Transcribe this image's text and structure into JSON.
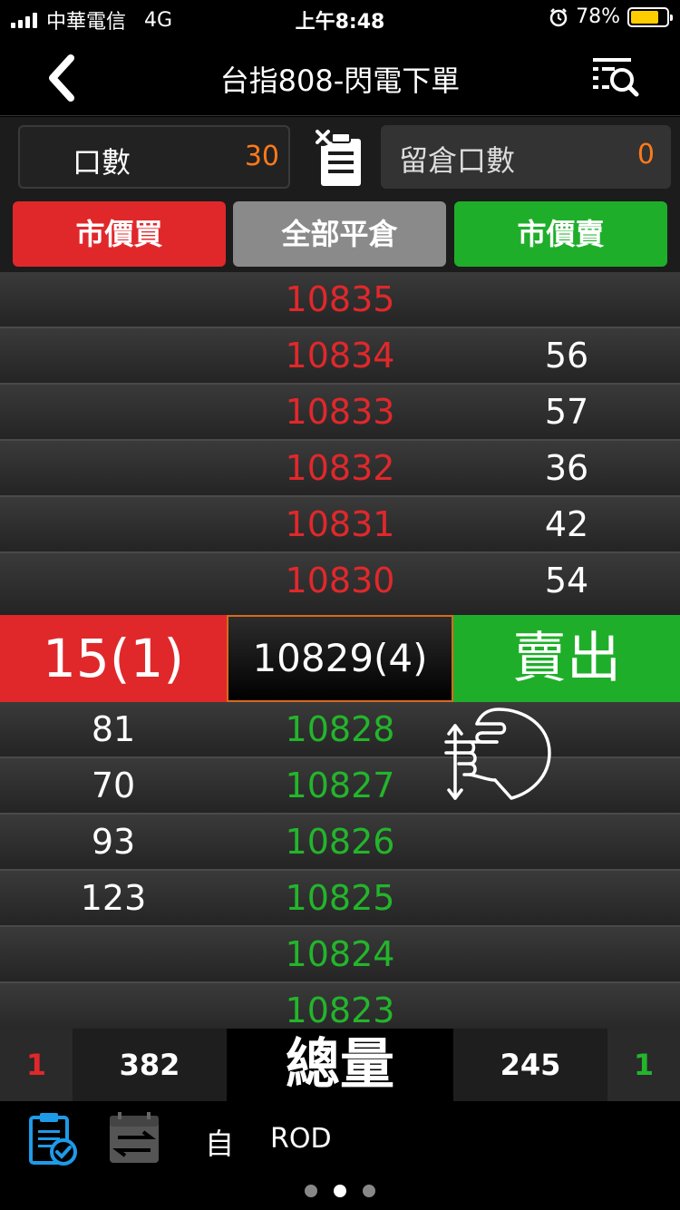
{
  "status_bar": {
    "carrier": "中華電信",
    "network": "4G",
    "time": "上午8:48",
    "battery_percent": "78%",
    "battery_level": 0.78
  },
  "nav": {
    "title": "台指808-閃電下單",
    "back_icon": "chevron-left-icon",
    "filter_icon": "list-search-icon"
  },
  "order_inputs": {
    "qty_label": "口數",
    "qty_value": "30",
    "hold_label": "留倉口數",
    "hold_value": "0"
  },
  "actions": {
    "market_buy": "市價買",
    "close_all": "全部平倉",
    "market_sell": "市價賣"
  },
  "ladder": {
    "asks": [
      {
        "price": "10835",
        "ask_qty": ""
      },
      {
        "price": "10834",
        "ask_qty": "56"
      },
      {
        "price": "10833",
        "ask_qty": "57"
      },
      {
        "price": "10832",
        "ask_qty": "36"
      },
      {
        "price": "10831",
        "ask_qty": "42"
      },
      {
        "price": "10830",
        "ask_qty": "54"
      }
    ],
    "center": {
      "buy_label": "15(1)",
      "last_price": "10829(4)",
      "sell_label": "賣出"
    },
    "bids": [
      {
        "bid_qty": "81",
        "price": "10828"
      },
      {
        "bid_qty": "70",
        "price": "10827"
      },
      {
        "bid_qty": "93",
        "price": "10826"
      },
      {
        "bid_qty": "123",
        "price": "10825"
      },
      {
        "bid_qty": "",
        "price": "10824"
      },
      {
        "bid_qty": "",
        "price": "10823"
      }
    ]
  },
  "totals": {
    "bid_orders": "1",
    "bid_total": "382",
    "label": "總量",
    "ask_total": "245",
    "ask_orders": "1"
  },
  "bottom_bar": {
    "self_label": "自",
    "order_type": "ROD",
    "page_count": 3,
    "active_page": 2
  },
  "colors": {
    "buy_red": "#e0282b",
    "sell_green": "#1fae2a",
    "accent_orange": "#ff7a1a",
    "icon_blue": "#1e9be8"
  }
}
